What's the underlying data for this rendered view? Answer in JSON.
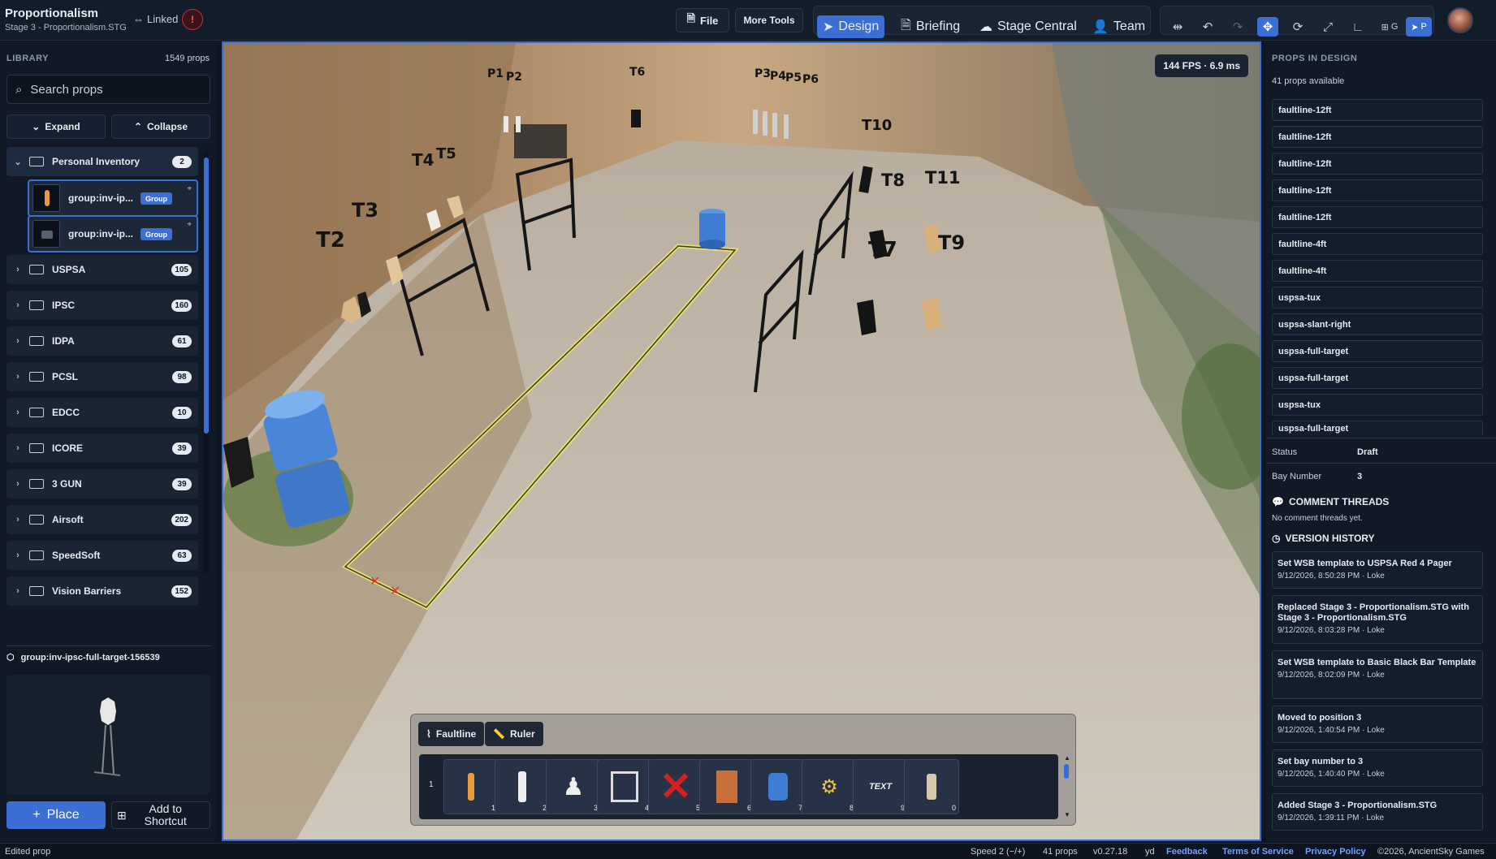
{
  "header": {
    "title": "Proportionalism",
    "subtitle": "Stage 3 - Proportionalism.STG",
    "linked_label": "Linked",
    "file_label": "File",
    "more_tools_label": "More Tools",
    "modes": [
      "Design",
      "Briefing",
      "Stage Central",
      "Team"
    ],
    "active_mode": "Design",
    "grid_label": "G",
    "snap_label": "P"
  },
  "library": {
    "label": "LIBRARY",
    "count": "1549 props",
    "search_placeholder": "Search props",
    "expand_label": "Expand",
    "collapse_label": "Collapse",
    "folders": [
      {
        "name": "Personal Inventory",
        "count": "2",
        "open": true
      },
      {
        "name": "USPSA",
        "count": "105"
      },
      {
        "name": "IPSC",
        "count": "160"
      },
      {
        "name": "IDPA",
        "count": "61"
      },
      {
        "name": "PCSL",
        "count": "98"
      },
      {
        "name": "EDCC",
        "count": "10"
      },
      {
        "name": "ICORE",
        "count": "39"
      },
      {
        "name": "3 GUN",
        "count": "39"
      },
      {
        "name": "Airsoft",
        "count": "202"
      },
      {
        "name": "SpeedSoft",
        "count": "63"
      },
      {
        "name": "Vision Barriers",
        "count": "152"
      }
    ],
    "inventory_items": [
      {
        "name": "group:inv-ip...",
        "badge": "Group"
      },
      {
        "name": "group:inv-ip...",
        "badge": "Group"
      }
    ],
    "selected_prop": "group:inv-ipsc-full-target-156539",
    "place_label": "Place",
    "shortcut_label": "Add to Shortcut"
  },
  "viewport": {
    "fps_readout": "144 FPS · 6.9 ms",
    "target_labels": [
      "P1",
      "P2",
      "T6",
      "P3",
      "P4",
      "P5",
      "P6",
      "T10",
      "T4",
      "T5",
      "T8",
      "T11",
      "T3",
      "T2",
      "T7",
      "T9"
    ],
    "hotbar": {
      "faultline_label": "Faultline",
      "ruler_label": "Ruler",
      "row_number": "1",
      "slots": [
        {
          "num": "1",
          "icon": "target-orange-icon"
        },
        {
          "num": "2",
          "icon": "target-white-icon"
        },
        {
          "num": "3",
          "icon": "popper-icon"
        },
        {
          "num": "4",
          "icon": "frame-icon"
        },
        {
          "num": "5",
          "icon": "no-shoot-x-icon"
        },
        {
          "num": "6",
          "icon": "wall-panel-icon"
        },
        {
          "num": "7",
          "icon": "barrel-icon"
        },
        {
          "num": "8",
          "icon": "activator-icon"
        },
        {
          "num": "9",
          "icon": "text-icon",
          "text": "TEXT"
        },
        {
          "num": "0",
          "icon": "target-tan-icon"
        }
      ]
    }
  },
  "props_panel": {
    "label": "PROPS IN DESIGN",
    "available": "41 props available",
    "items": [
      "faultline-12ft",
      "faultline-12ft",
      "faultline-12ft",
      "faultline-12ft",
      "faultline-12ft",
      "faultline-4ft",
      "faultline-4ft",
      "uspsa-tux",
      "uspsa-slant-right",
      "uspsa-full-target",
      "uspsa-full-target",
      "uspsa-tux",
      "uspsa-full-target"
    ],
    "status_key": "Status",
    "status_value": "Draft",
    "bay_key": "Bay Number",
    "bay_value": "3",
    "comments_label": "COMMENT THREADS",
    "comments_empty": "No comment threads yet.",
    "versions_label": "VERSION HISTORY",
    "versions": [
      {
        "title": "Set WSB template to USPSA Red 4 Pager",
        "meta": "9/12/2026, 8:50:28 PM · Loke"
      },
      {
        "title": "Replaced Stage 3 - Proportionalism.STG with Stage 3 - Proportionalism.STG",
        "meta": "9/12/2026, 8:03:28 PM · Loke"
      },
      {
        "title": "Set WSB template to Basic Black Bar Template",
        "meta": "9/12/2026, 8:02:09 PM · Loke"
      },
      {
        "title": "Moved to position 3",
        "meta": "9/12/2026, 1:40:54 PM · Loke"
      },
      {
        "title": "Set bay number to 3",
        "meta": "9/12/2026, 1:40:40 PM · Loke"
      },
      {
        "title": "Added Stage 3 - Proportionalism.STG",
        "meta": "9/12/2026, 1:39:11 PM · Loke"
      }
    ]
  },
  "statusbar": {
    "message": "Edited prop",
    "speed": "Speed 2 (−/+)",
    "props": "41 props",
    "version": "v0.27.18",
    "units": "yd",
    "feedback": "Feedback",
    "terms": "Terms of Service",
    "privacy": "Privacy Policy",
    "copyright": "©2026, AncientSky Games"
  },
  "colors": {
    "accent": "#3b6fd4",
    "warning": "#ff5561",
    "link": "#6fa3ff"
  }
}
